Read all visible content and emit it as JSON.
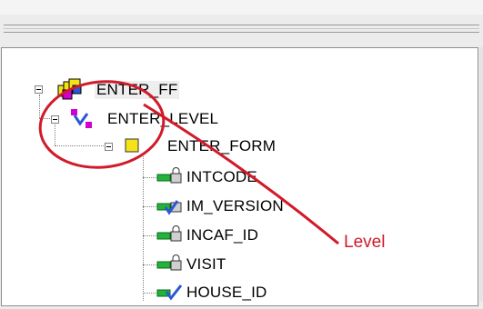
{
  "tree": {
    "root": {
      "label": "ENTER_FF",
      "icon": "file-stack-icon"
    },
    "level": {
      "label": "ENTER_LEVEL",
      "icon": "level-icon"
    },
    "form": {
      "label": "ENTER_FORM",
      "icon": "form-icon"
    },
    "items": [
      {
        "label": "INTCODE",
        "icon": "locked-item-icon"
      },
      {
        "label": "IM_VERSION",
        "icon": "locked-checked-item-icon"
      },
      {
        "label": "INCAF_ID",
        "icon": "locked-item-icon"
      },
      {
        "label": "VISIT",
        "icon": "locked-item-icon"
      },
      {
        "label": "HOUSE_ID",
        "icon": "checked-item-icon"
      }
    ]
  },
  "annotation": {
    "text": "Level",
    "color": "#d11a2a"
  },
  "colors": {
    "icon_green": "#22b33a",
    "icon_yellow": "#f4e21a",
    "icon_magenta": "#d100d1",
    "icon_blue": "#2a57d8"
  }
}
